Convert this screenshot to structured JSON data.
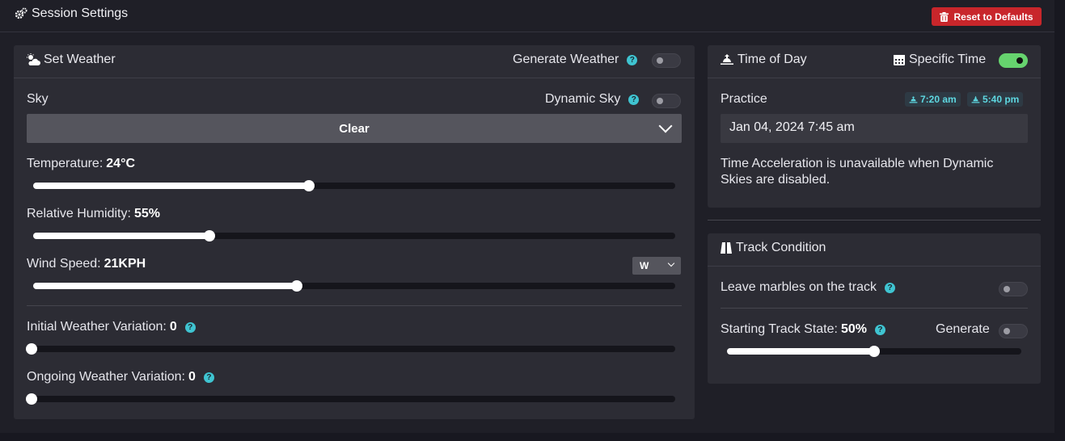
{
  "header": {
    "title": "Session Settings",
    "reset_label": "Reset to Defaults"
  },
  "weather": {
    "title": "Set Weather",
    "generate_label": "Generate Weather",
    "generate_on": false,
    "sky_label": "Sky",
    "dynamic_sky_label": "Dynamic Sky",
    "dynamic_sky_on": false,
    "sky_value": "Clear",
    "temperature_label": "Temperature:",
    "temperature_value": "24°C",
    "temperature_level": 0.43,
    "humidity_label": "Relative Humidity:",
    "humidity_value": "55%",
    "humidity_level": 0.275,
    "wind_label": "Wind Speed:",
    "wind_value": "21KPH",
    "wind_level": 0.41,
    "wind_dir": "W",
    "initial_var_label": "Initial Weather Variation:",
    "initial_var_value": "0",
    "initial_var_level": 0,
    "ongoing_var_label": "Ongoing Weather Variation:",
    "ongoing_var_value": "0",
    "ongoing_var_level": 0
  },
  "time_of_day": {
    "title": "Time of Day",
    "specific_label": "Specific Time",
    "specific_on": true,
    "session_label": "Practice",
    "sunrise": "7:20 am",
    "sunset": "5:40 pm",
    "datetime": "Jan 04, 2024 7:45 am",
    "note": "Time Acceleration is unavailable when Dynamic Skies are disabled."
  },
  "track": {
    "title": "Track Condition",
    "marbles_label": "Leave marbles on the track",
    "marbles_on": false,
    "state_label": "Starting Track State:",
    "state_value": "50%",
    "state_level": 0.5,
    "generate_label": "Generate",
    "generate_on": false
  },
  "colors": {
    "accent": "#3fc4d1",
    "danger": "#c8262b",
    "on": "#66d36e"
  },
  "help_glyph": "?"
}
